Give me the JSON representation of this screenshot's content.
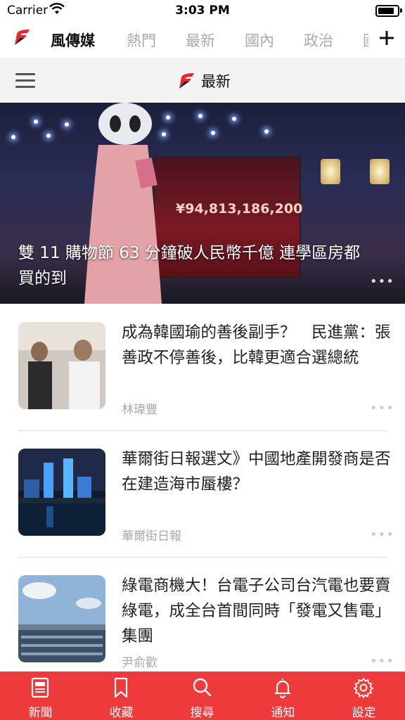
{
  "status_bar": {
    "carrier": "Carrier",
    "time": "3:03 PM"
  },
  "top_nav": {
    "brand_label": "風傳媒",
    "tabs": [
      "熱門",
      "最新",
      "國內",
      "政治"
    ],
    "add_icon": "plus-icon"
  },
  "sub_header": {
    "title": "最新",
    "menu_icon": "hamburger-icon"
  },
  "hero": {
    "caption": "雙 11 購物節 63 分鐘破人民幣千億 連學區房都買的到",
    "screen_text": "¥94,813,186,200"
  },
  "articles": [
    {
      "title": "成為韓國瑜的善後副手？　民進黨：張善政不停善後，比韓更適合選總統",
      "author": "林瑋豐"
    },
    {
      "title": "華爾街日報選文》中國地產開發商是否在建造海市蜃樓？",
      "author": "華爾街日報"
    },
    {
      "title": "綠電商機大！台電子公司台汽電也要賣綠電，成全台首間同時「發電又售電」集團",
      "author": "尹俞歡"
    }
  ],
  "tab_bar": {
    "items": [
      {
        "label": "新聞",
        "icon": "newspaper-icon"
      },
      {
        "label": "收藏",
        "icon": "bookmark-icon"
      },
      {
        "label": "搜尋",
        "icon": "search-icon"
      },
      {
        "label": "通知",
        "icon": "bell-icon"
      },
      {
        "label": "設定",
        "icon": "gear-icon"
      }
    ]
  },
  "colors": {
    "accent": "#ef3a3c",
    "muted_text": "#aaaaaa"
  }
}
